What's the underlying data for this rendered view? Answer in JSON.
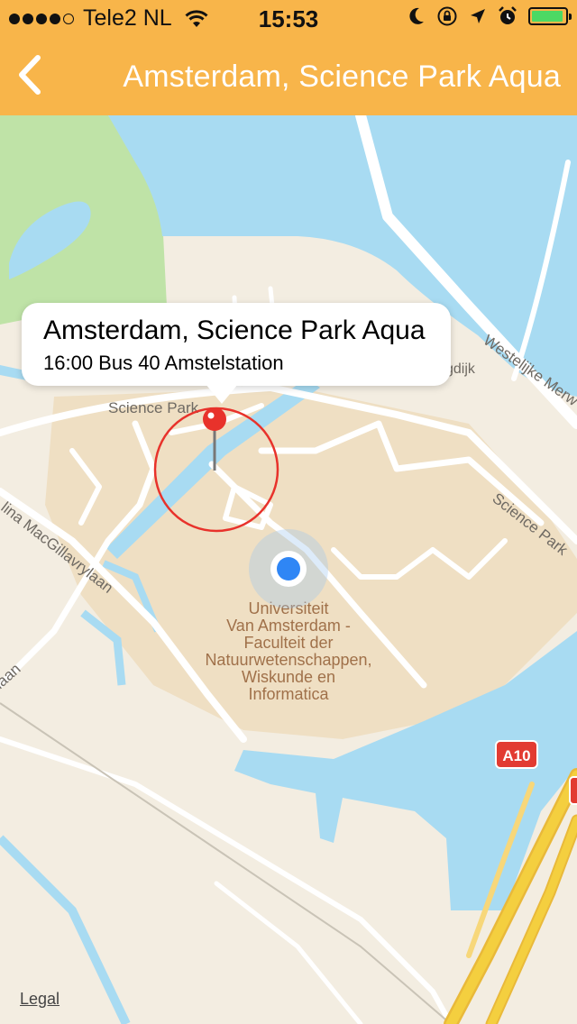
{
  "status_bar": {
    "carrier": "Tele2 NL",
    "time": "15:53",
    "signal_bars_filled": 4,
    "signal_bars_total": 5,
    "battery_level": 0.9,
    "icons": [
      "wifi-icon",
      "moon-icon",
      "orientation-lock-icon",
      "location-arrow-icon",
      "alarm-icon",
      "battery-icon"
    ]
  },
  "nav": {
    "title": "Amsterdam, Science Park Aqua",
    "back_icon": "chevron-left-icon"
  },
  "callout": {
    "title": "Amsterdam, Science Park Aqua",
    "subtitle": "16:00 Bus 40 Amstelstation"
  },
  "map": {
    "labels": {
      "science_park_1": "Science Park",
      "science_park_2": "Science Park",
      "westelijke": "Westelijke Merw",
      "ringdijk": "Ringdijk",
      "catalina": "lina MacGillavrylaan",
      "aan": "laan",
      "uva_line1": "Universiteit",
      "uva_line2": "Van Amsterdam -",
      "uva_line3": "Faculteit der",
      "uva_line4": "Natuurwetenschappen,",
      "uva_line5": "Wiskunde en",
      "uva_line6": "Informatica",
      "highway_shield": "A10"
    },
    "legal": "Legal",
    "colors": {
      "land": "#f3ede1",
      "campus": "#efdfc3",
      "water": "#a8dbf2",
      "park": "#bfe3a7",
      "road": "#ffffff",
      "highway": "#f4cf3f",
      "pin": "#e8322b",
      "user_location": "#2f86f5",
      "nav_bar": "#f8b54a"
    }
  }
}
